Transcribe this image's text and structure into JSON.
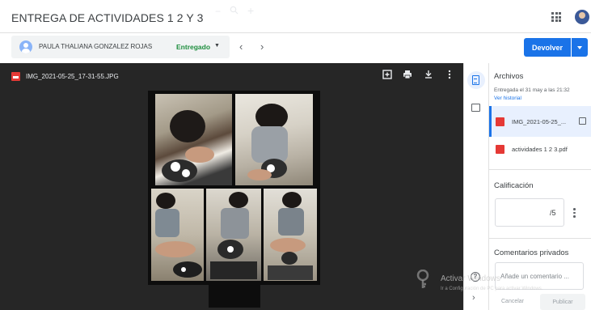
{
  "header": {
    "title": "ENTREGA DE ACTIVIDADES 1 2 Y 3"
  },
  "student_bar": {
    "student_name": "PAULA THALIANA GONZALEZ ROJAS",
    "status": "Entregado",
    "return_button": "Devolver"
  },
  "viewer": {
    "file_name": "IMG_2021-05-25_17-31-55.JPG",
    "zoom_out": "−",
    "zoom_in": "+"
  },
  "panel": {
    "files_heading": "Archivos",
    "submitted_text": "Entregada el 31 may a las 21:32",
    "history_link": "Ver historial",
    "files": [
      {
        "label": "IMG_2021-05-25_..."
      },
      {
        "label": "actividades 1 2 3.pdf"
      }
    ],
    "grade_heading": "Calificación",
    "grade_value": "/5",
    "comments_heading": "Comentarios privados",
    "comment_placeholder": "Añade un comentario ...",
    "cancel_label": "Cancelar",
    "publish_label": "Publicar"
  },
  "watermark": {
    "line1": "Activar Windows",
    "line2": "Ir a Configuración de PC para activar Windows."
  },
  "colors": {
    "accent": "#1a73e8",
    "status_green": "#1e8e3e",
    "viewer_bg": "#262626"
  }
}
